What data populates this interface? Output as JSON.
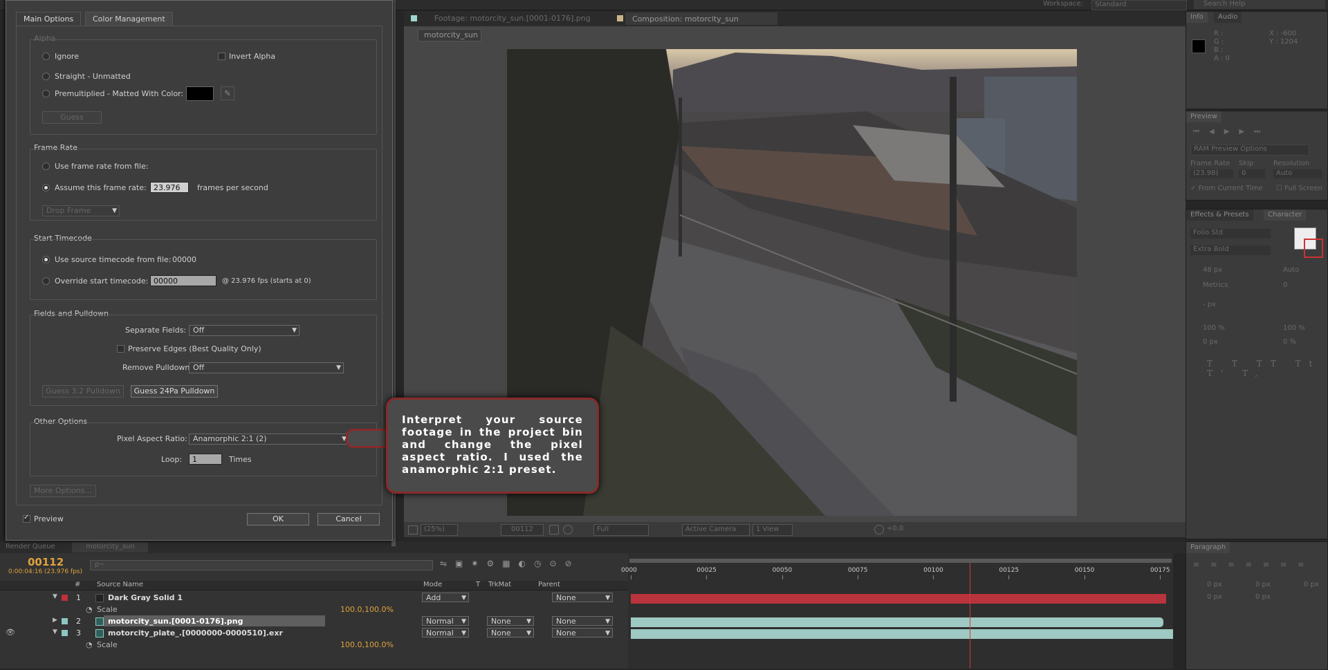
{
  "workspace": {
    "label": "Workspace:",
    "value": "Standard",
    "search_placeholder": "Search Help"
  },
  "dialog": {
    "tabs": [
      "Main Options",
      "Color Management"
    ],
    "alpha": {
      "title": "Alpha",
      "ignore": "Ignore",
      "invert": "Invert Alpha",
      "straight": "Straight - Unmatted",
      "premult": "Premultiplied - Matted With Color:",
      "guess": "Guess"
    },
    "frame_rate": {
      "title": "Frame Rate",
      "use_file": "Use frame rate from file:",
      "assume": "Assume this frame rate:",
      "value": "23.976",
      "unit": "frames per second",
      "drop": "Drop Frame"
    },
    "start_timecode": {
      "title": "Start Timecode",
      "use_source": "Use source timecode from file:",
      "source_value": "00000",
      "override": "Override start timecode:",
      "override_value": "00000",
      "fps_note": "@ 23.976 fps (starts at 0)"
    },
    "fields": {
      "title": "Fields and Pulldown",
      "separate_label": "Separate Fields:",
      "separate_value": "Off",
      "preserve": "Preserve Edges (Best Quality Only)",
      "remove_label": "Remove Pulldown:",
      "remove_value": "Off",
      "guess32": "Guess 3:2 Pulldown",
      "guess24": "Guess 24Pa Pulldown"
    },
    "other": {
      "title": "Other Options",
      "par_label": "Pixel Aspect Ratio:",
      "par_value": "Anamorphic 2:1 (2)",
      "loop_label": "Loop:",
      "loop_value": "1",
      "loop_unit": "Times",
      "more": "More Options..."
    },
    "preview": "Preview",
    "ok": "OK",
    "cancel": "Cancel"
  },
  "comp": {
    "tabs": [
      "Footage: motorcity_sun.[0001-0176].png",
      "Composition: motorcity_sun"
    ],
    "breadcrumb": "motorcity_sun",
    "viewer_bar": {
      "zoom": "(25%)",
      "frame": "00112",
      "res": "Full",
      "camera": "Active Camera",
      "view": "1 View",
      "exposure": "+0.0"
    }
  },
  "callout": {
    "text": "Interpret your source footage in the project bin and change the pixel aspect ratio. I used the anamorphic 2:1 preset."
  },
  "info_panel": {
    "tabs": [
      "Info",
      "Audio"
    ],
    "r": "R :",
    "g": "G :",
    "b": "B :",
    "a": "A : 0",
    "x": "X : -600",
    "y": "Y : 1204"
  },
  "preview_panel": {
    "title": "Preview",
    "ram": "RAM Preview Options",
    "frame_rate_label": "Frame Rate",
    "skip_label": "Skip",
    "resolution_label": "Resolution",
    "frame_rate": "(23.98)",
    "skip": "0",
    "resolution": "Auto",
    "from_current": "From Current Time",
    "full_screen": "Full Screen"
  },
  "character_panel": {
    "tabs": [
      "Effects & Presets",
      "Character"
    ],
    "font": "Folio Std",
    "style": "Extra Bold",
    "size": "48 px",
    "leading": "Auto",
    "kerning": "Metrics",
    "tracking": "0",
    "stroke": "- px",
    "vscale": "100 %",
    "hscale": "100 %",
    "baseline": "0 px",
    "tsume": "0 %"
  },
  "paragraph_panel": {
    "title": "Paragraph",
    "indent1": "0 px",
    "indent2": "0 px",
    "indent3": "0 px",
    "space1": "0 px",
    "space2": "0 px"
  },
  "timeline": {
    "tabs": [
      "Render Queue",
      "motorcity_sun"
    ],
    "timecode": "00112",
    "timecode_sub": "0:00:04:16 (23.976 fps)",
    "search_placeholder": "ρ~",
    "columns": {
      "num": "#",
      "source": "Source Name",
      "mode": "Mode",
      "t": "T",
      "trkmat": "TrkMat",
      "parent": "Parent"
    },
    "layers": [
      {
        "num": "1",
        "name": "Dark Gray Solid 1",
        "mode": "Add",
        "trkmat": "",
        "parent": "None",
        "color": "#c0303a"
      },
      {
        "num": "2",
        "name": "motorcity_sun.[0001-0176].png",
        "mode": "Normal",
        "trkmat": "None",
        "parent": "None",
        "color": "#8cc7c1"
      },
      {
        "num": "3",
        "name": "motorcity_plate_.[0000000-0000510].exr",
        "mode": "Normal",
        "trkmat": "None",
        "parent": "None",
        "color": "#8cc7c1"
      }
    ],
    "scale_label": "Scale",
    "scale_value": "100.0,100.0%",
    "ruler": [
      "0000",
      "00025",
      "00050",
      "00075",
      "00100",
      "00125",
      "00150",
      "00175"
    ],
    "playhead_frame": 112
  }
}
